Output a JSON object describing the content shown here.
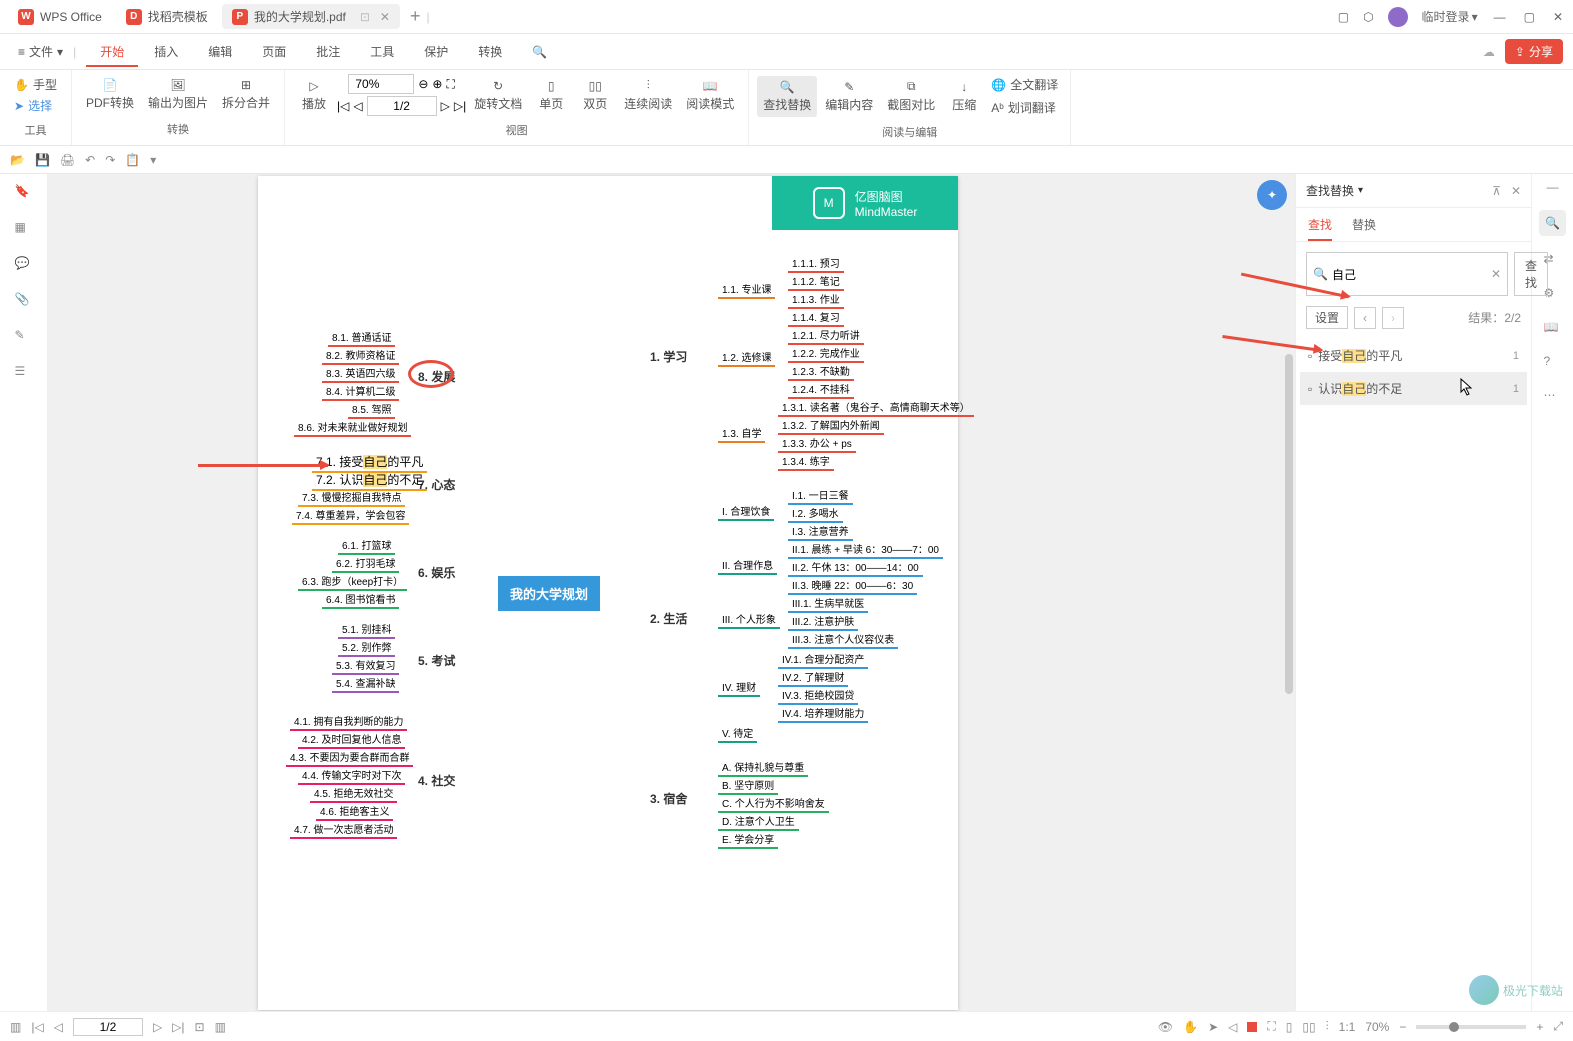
{
  "titlebar": {
    "tabs": [
      {
        "name": "WPS Office",
        "icon": "wps"
      },
      {
        "name": "找稻壳模板",
        "icon": "tpl"
      },
      {
        "name": "我的大学规划.pdf",
        "icon": "pdf",
        "active": true
      }
    ],
    "login": "临时登录"
  },
  "menubar": {
    "file": "文件",
    "items": [
      "开始",
      "插入",
      "编辑",
      "页面",
      "批注",
      "工具",
      "保护",
      "转换"
    ],
    "active": 0,
    "share": "分享"
  },
  "toolbar": {
    "hand": "手型",
    "select": "选择",
    "tools_label": "工具",
    "pdf_convert": "PDF转换",
    "export_img": "输出为图片",
    "split_merge": "拆分合并",
    "convert_label": "转换",
    "play": "播放",
    "zoom": "70%",
    "rotate": "旋转文档",
    "single": "单页",
    "double": "双页",
    "continuous": "连续阅读",
    "read_mode": "阅读模式",
    "view_label": "视图",
    "page": "1/2",
    "find_replace": "查找替换",
    "edit_content": "编辑内容",
    "compare": "截图对比",
    "compress": "压缩",
    "full_translate": "全文翻译",
    "word_translate": "划词翻译",
    "read_edit_label": "阅读与编辑"
  },
  "rightpanel": {
    "title": "查找替换",
    "tab_find": "查找",
    "tab_replace": "替换",
    "search_value": "自己",
    "search_btn": "查找",
    "settings": "设置",
    "result_label": "结果：",
    "result_count": "2/2",
    "results": [
      {
        "pre": "接受",
        "hl": "自己",
        "post": "的平凡",
        "n": "1"
      },
      {
        "pre": "认识",
        "hl": "自己",
        "post": "的不足",
        "n": "1"
      }
    ]
  },
  "statusbar": {
    "page": "1/2",
    "zoom": "70%"
  },
  "doc": {
    "badge_cn": "亿图脑图",
    "badge_en": "MindMaster",
    "center": "我的大学规划",
    "b1": "1. 学习",
    "b2": "2. 生活",
    "b3": "3. 宿舍",
    "b4": "4. 社交",
    "b5": "5. 考试",
    "b6": "6. 娱乐",
    "b7": "7. 心态",
    "b8": "8. 发展",
    "n11": "1.1. 专业课",
    "n12": "1.2. 选修课",
    "n13": "1.3. 自学",
    "n111": "1.1.1. 预习",
    "n112": "1.1.2. 笔记",
    "n113": "1.1.3. 作业",
    "n114": "1.1.4. 复习",
    "n121": "1.2.1. 尽力听讲",
    "n122": "1.2.2. 完成作业",
    "n123": "1.2.3. 不缺勤",
    "n124": "1.2.4. 不挂科",
    "n131": "1.3.1. 读名著（鬼谷子、高情商聊天术等）",
    "n132": "1.3.2. 了解国内外新闻",
    "n133": "1.3.3. 办公 + ps",
    "n134": "1.3.4. 练字",
    "n21": "I. 合理饮食",
    "n22": "II. 合理作息",
    "n23": "III. 个人形象",
    "n24": "IV. 理财",
    "n25": "V. 待定",
    "n211": "I.1. 一日三餐",
    "n212": "I.2. 多喝水",
    "n213": "I.3. 注意营养",
    "n221": "II.1. 晨练 + 早读  6：30——7：00",
    "n222": "II.2. 午休  13：00——14：00",
    "n223": "II.3. 晚睡  22：00——6：30",
    "n231": "III.1. 生病早就医",
    "n232": "III.2. 注意护肤",
    "n233": "III.3. 注意个人仪容仪表",
    "n241": "IV.1. 合理分配资产",
    "n242": "IV.2. 了解理财",
    "n243": "IV.3. 拒绝校园贷",
    "n244": "IV.4. 培养理财能力",
    "n31": "A. 保持礼貌与尊重",
    "n32": "B. 坚守原则",
    "n33": "C. 个人行为不影响舍友",
    "n34": "D. 注意个人卫生",
    "n35": "E. 学会分享",
    "n41": "4.1. 拥有自我判断的能力",
    "n42": "4.2. 及时回复他人信息",
    "n43": "4.3. 不要因为要合群而合群",
    "n44": "4.4. 传输文字时对下次",
    "n45": "4.5. 拒绝无效社交",
    "n46": "4.6. 拒绝客主义",
    "n47": "4.7. 做一次志愿者活动",
    "n51": "5.1. 别挂科",
    "n52": "5.2. 别作弊",
    "n53": "5.3. 有效复习",
    "n54": "5.4. 查漏补缺",
    "n61": "6.1. 打篮球",
    "n62": "6.2. 打羽毛球",
    "n63": "6.3. 跑步（keep打卡）",
    "n64": "6.4. 图书馆看书",
    "n71": "7.1. 接受",
    "n71h": "自己",
    "n71b": "的平凡",
    "n72": "7.2. 认识",
    "n72h": "自己",
    "n72b": "的不足",
    "n73": "7.3. 慢慢挖掘自我特点",
    "n74": "7.4. 尊重差异，学会包容",
    "n81": "8.1. 普通话证",
    "n82": "8.2. 教师资格证",
    "n83": "8.3. 英语四六级",
    "n84": "8.4. 计算机二级",
    "n85": "8.5. 驾照",
    "n86": "8.6. 对未来就业做好规划"
  }
}
